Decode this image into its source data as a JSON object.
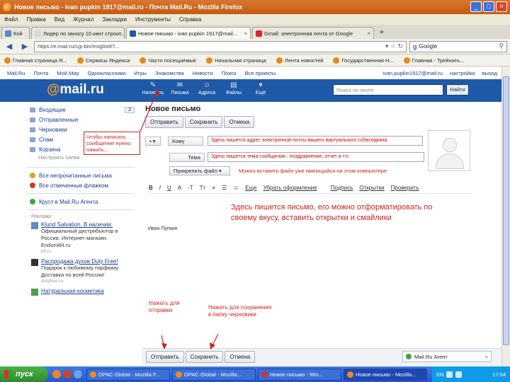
{
  "window": {
    "title": "Новое письмо - ivan pupkin 1917@mail.ru - Почта Mail.Ru - Mozilla Firefox",
    "controls": [
      "_",
      "□",
      "×"
    ]
  },
  "menu": [
    "Файл",
    "Правка",
    "Вид",
    "Журнал",
    "Закладки",
    "Инструменты",
    "Справка"
  ],
  "tabs": [
    {
      "label": "Кой",
      "icon": "page-icon"
    },
    {
      "label": "Лидер по заносу 10 кинт строит...",
      "icon": "page-icon"
    },
    {
      "label": "Новое письмо - ivan pupkin 1917@mail...",
      "icon": "mailru-icon"
    },
    {
      "label": "Gmail: электронная почта от Google",
      "icon": "gmail-icon"
    }
  ],
  "nav": {
    "url": "https://e.mail.ru/cgi-bin/msglist#?...",
    "search_engine": "Google"
  },
  "bookmarks": [
    "Главная страница Я...",
    "Сервисы Яндекса",
    "Часто посещаемые",
    "Начальная страница",
    "Лента новостей",
    "Государственная Н...",
    "Главная - Трейнать..."
  ],
  "portal": {
    "links": [
      "Mail.Ru",
      "Почта",
      "Мой Мир",
      "Одноклассники",
      "Игры",
      "Знакомства",
      "Новости",
      "Поиск",
      "Все проекты"
    ],
    "right": [
      "ivan.pupkin1917@mail.ru",
      "настройки",
      "выход"
    ]
  },
  "header": {
    "logo_at": "@",
    "logo_text": "mail.ru",
    "icons": [
      {
        "label": "Написать",
        "icon": "pencil-icon"
      },
      {
        "label": "Письма",
        "icon": "envelope-icon"
      },
      {
        "label": "Адреса",
        "icon": "contacts-icon"
      },
      {
        "label": "Файлы",
        "icon": "files-icon"
      },
      {
        "label": "Ещё",
        "icon": "more-icon"
      }
    ],
    "search_placeholder": "Поиск по почте",
    "search_button": "Найти"
  },
  "sidebar": {
    "folders": [
      {
        "label": "Входящие",
        "count": "2"
      },
      {
        "label": "Отправленные",
        "count": ""
      },
      {
        "label": "Черновики",
        "count": ""
      },
      {
        "label": "Спам",
        "count": ""
      },
      {
        "label": "Корзина",
        "count": ""
      }
    ],
    "settings_link": "Настроить папки",
    "extra": [
      {
        "label": "Все непрочитанные письма",
        "color": "#e0a020"
      },
      {
        "label": "Все отмеченные флажком",
        "color": "#d43a2a"
      }
    ],
    "mail_agent": "Кругл в Mail.Ru Агента",
    "ads_label": "Реклама",
    "ads": [
      {
        "title": "Klund Salvation. В наличии.",
        "desc": "Официальный дистрибьютор в России. Интернет-магазин. Enduro84.ru",
        "domain": "klf.ru"
      },
      {
        "title": "Распродажа духов Duty Free!",
        "desc": "Подарок к любимому парфюму. Доставка по всей России!",
        "domain": "dutyfree.ru"
      },
      {
        "title": "Натуральная косметика",
        "desc": "",
        "domain": ""
      }
    ]
  },
  "compose": {
    "title": "Новое письмо",
    "buttons": [
      "Отправить",
      "Сохранить",
      "Отмена"
    ],
    "to_label": "Кому",
    "to_value": "Здесь пишется адрес электронной почты вашего виртуального собеседника",
    "subject_label": "Тема",
    "subject_value": "Здесь пишется тема сообщения : поздравление, отчет и т.п.",
    "attach_label": "Прикрепить файл",
    "attach_note": "Можно вставить файл уже имеющийся на этом компьютере",
    "toolbar": [
      "B",
      "I",
      "U",
      "A",
      "-T",
      "Tт",
      "≡",
      "☰",
      "☺",
      "Еще",
      "Убрать оформление",
      "Подпись",
      "Открытки",
      "Проверить"
    ],
    "signature": "Иван Пупкин",
    "body_note": "Здесь пишется письмо, его можно отформатировать по своему вкусу, вставить открытки и смайлики",
    "bottom_buttons": [
      "Отправить",
      "Сохранить",
      "Отмена"
    ],
    "agent_label": "Mail.Ru Агент"
  },
  "annotations": {
    "write_note": "Чтобы написать сообщение нужно нажать...",
    "send_note": "Нажать для отправки",
    "save_note": "Нажать для сохранения в папку черновики",
    "color": "#cc2222"
  },
  "taskbar": {
    "start": "пуск",
    "tasks": [
      "ОРАС-Global - Mozilla F...",
      "ОРАС-Global - Mozilla...",
      "Новое письмо - Win...",
      "Новое письмо - Mozilla..."
    ],
    "lang": "EN",
    "clock": "17:04"
  }
}
